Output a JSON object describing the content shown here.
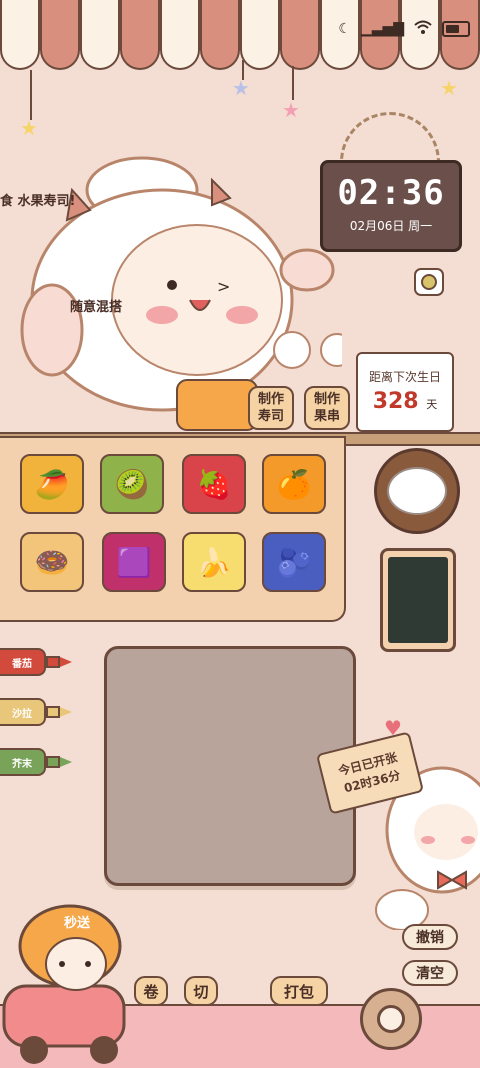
{
  "status_bar": {
    "icons": [
      "moon-icon",
      "signal-icon",
      "wifi-icon",
      "battery-icon"
    ]
  },
  "clock": {
    "time": "02:36",
    "date": "02月06日 周一"
  },
  "marquee": {
    "text": "食 水果寿司!"
  },
  "mascot": {
    "label": "随意混搭"
  },
  "make_buttons": [
    {
      "line1": "制作",
      "line2": "寿司"
    },
    {
      "line1": "制作",
      "line2": "果串"
    }
  ],
  "countdown": {
    "title": "距离下次生日",
    "value": "328",
    "unit": "天"
  },
  "fruits": [
    {
      "name": "mango",
      "glyph": "🥭",
      "color": "#f2b33d"
    },
    {
      "name": "kiwi",
      "glyph": "🥝",
      "color": "#8fb34a"
    },
    {
      "name": "strawberry",
      "glyph": "🍓",
      "color": "#d9434a"
    },
    {
      "name": "orange",
      "glyph": "🍊",
      "color": "#f39a2b"
    },
    {
      "name": "cereal-rings",
      "glyph": "🍩",
      "color": "#f3c57a"
    },
    {
      "name": "dragon-fruit",
      "glyph": "🟪",
      "color": "#c0306a"
    },
    {
      "name": "banana",
      "glyph": "🍌",
      "color": "#f7dc6f"
    },
    {
      "name": "blueberry",
      "glyph": "🫐",
      "color": "#4a5ec0"
    }
  ],
  "sauces": [
    {
      "label": "番茄",
      "color": "#d24a3c"
    },
    {
      "label": "沙拉",
      "color": "#e9c77a"
    },
    {
      "label": "芥末",
      "color": "#7aa35a"
    }
  ],
  "sign": {
    "line1": "今日已开张",
    "line2": "02时36分"
  },
  "side_buttons": {
    "undo": "撤销",
    "clear": "清空"
  },
  "tools": {
    "roll": "卷",
    "cut": "切",
    "pack": "打包"
  },
  "delivery": {
    "badge": "秒送"
  }
}
